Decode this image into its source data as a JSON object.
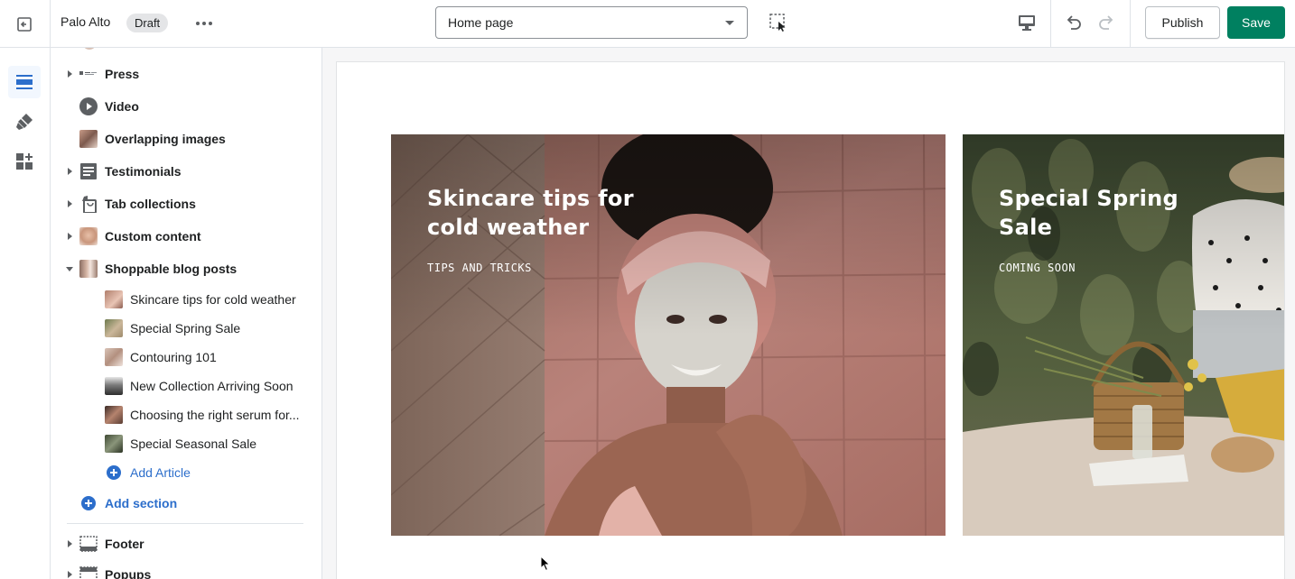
{
  "topbar": {
    "theme_name": "Palo Alto",
    "status_badge": "Draft",
    "more_label": "•••",
    "page_select_value": "Home page",
    "publish_label": "Publish",
    "save_label": "Save"
  },
  "sidebar": {
    "sections": [
      {
        "label": "Press",
        "icon": "press-logo-icon",
        "collapsible": true
      },
      {
        "label": "Video",
        "icon": "play-icon",
        "collapsible": false
      },
      {
        "label": "Overlapping images",
        "icon": "image-thumbnail",
        "collapsible": false
      },
      {
        "label": "Testimonials",
        "icon": "document-lines-icon",
        "collapsible": true
      },
      {
        "label": "Tab collections",
        "icon": "shopping-bag-icon",
        "collapsible": true
      },
      {
        "label": "Custom content",
        "icon": "image-thumbnail",
        "collapsible": true
      },
      {
        "label": "Shoppable blog posts",
        "icon": "image-thumbnail",
        "collapsible": true,
        "expanded": true
      }
    ],
    "blog_posts": [
      {
        "label": "Skincare tips for cold weather"
      },
      {
        "label": "Special Spring Sale"
      },
      {
        "label": "Contouring 101"
      },
      {
        "label": "New Collection Arriving Soon"
      },
      {
        "label": "Choosing the right serum for..."
      },
      {
        "label": "Special Seasonal Sale"
      }
    ],
    "add_article_label": "Add Article",
    "add_section_label": "Add section",
    "footer_sections": [
      {
        "label": "Footer",
        "icon": "footer-layout-icon"
      },
      {
        "label": "Popups",
        "icon": "footer-layout-icon"
      }
    ]
  },
  "preview": {
    "cards": [
      {
        "title": "Skincare tips for cold weather",
        "tag": "TIPS AND TRICKS"
      },
      {
        "title": "Special Spring Sale",
        "tag": "COMING SOON"
      }
    ]
  },
  "colors": {
    "primary_green": "#008060",
    "link_blue": "#2c6ecb",
    "active_rail": "#2c6ecb"
  }
}
